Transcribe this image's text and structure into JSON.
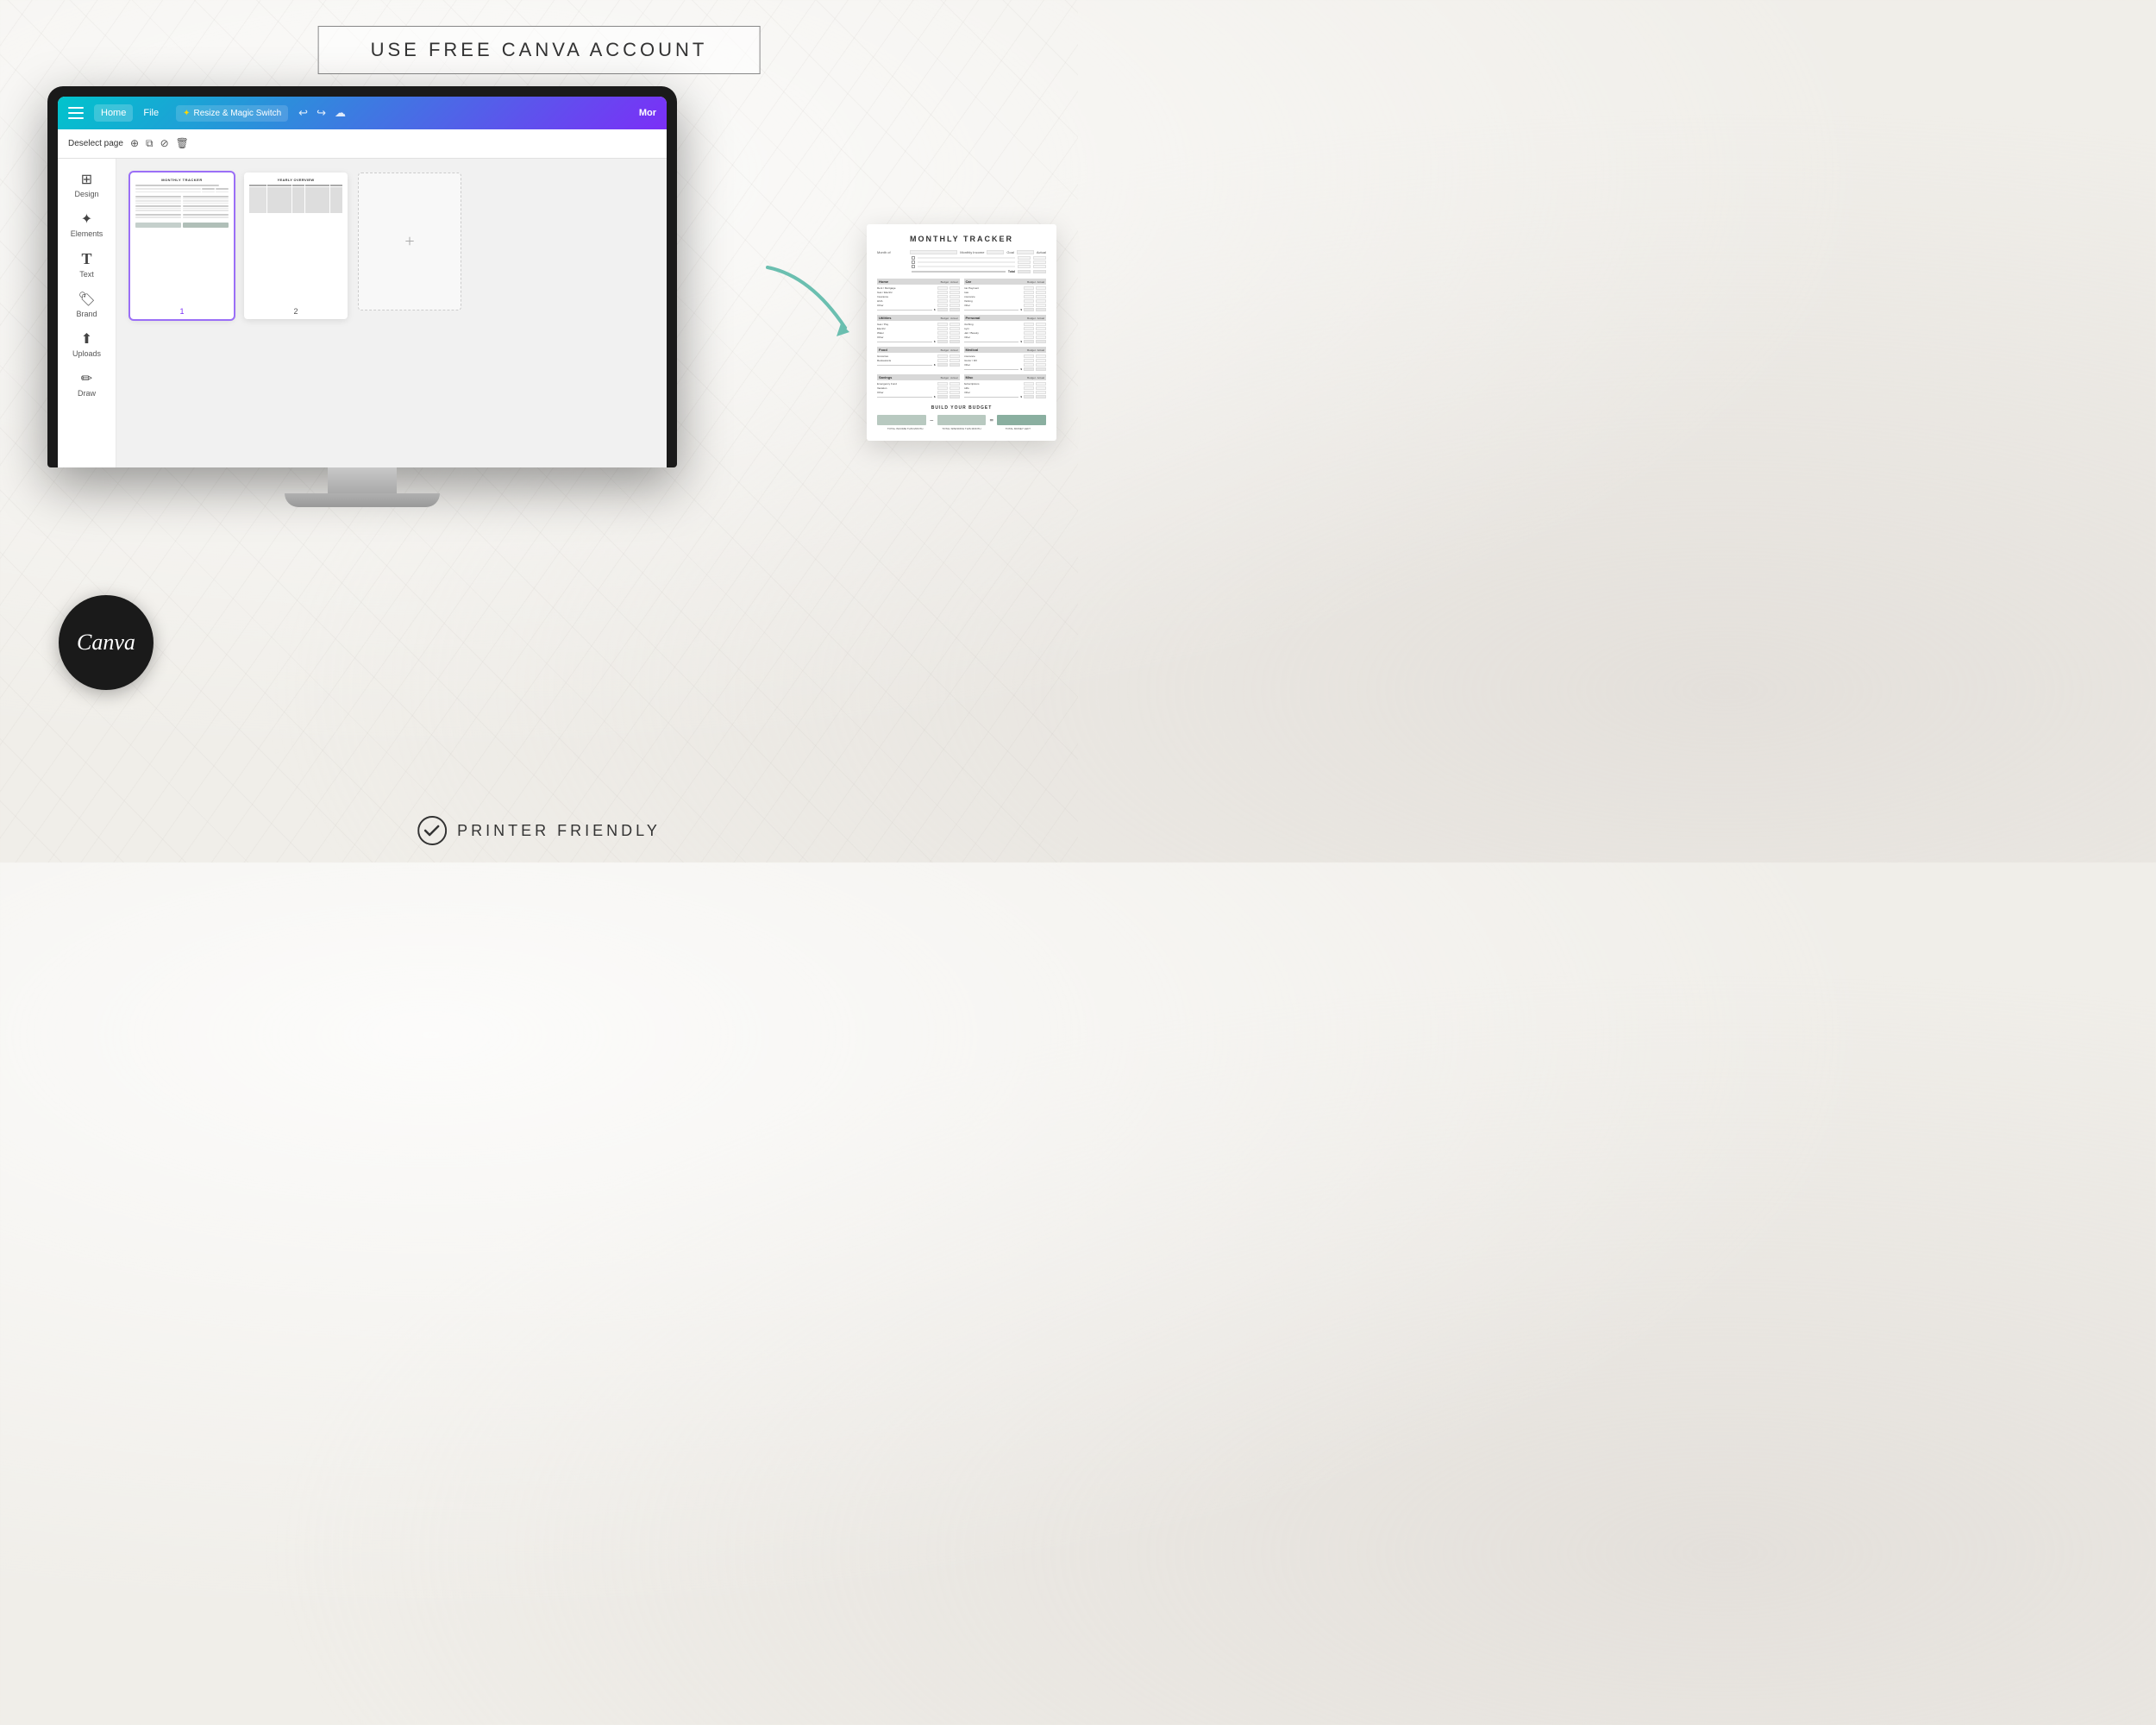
{
  "banner": {
    "text": "USE FREE CANVA ACCOUNT"
  },
  "toolbar": {
    "home_label": "Home",
    "file_label": "File",
    "magic_switch_label": "Resize & Magic Switch",
    "more_label": "Mor"
  },
  "secondary_toolbar": {
    "deselect_label": "Deselect page"
  },
  "sidebar": {
    "items": [
      {
        "label": "Design",
        "icon": "⊞"
      },
      {
        "label": "Elements",
        "icon": "❋"
      },
      {
        "label": "Text",
        "icon": "T"
      },
      {
        "label": "Brand",
        "icon": "🏷"
      },
      {
        "label": "Uploads",
        "icon": "↑"
      },
      {
        "label": "Draw",
        "icon": "✏"
      }
    ]
  },
  "pages": [
    {
      "label": "1",
      "title": "MONTHLY TRACKER",
      "selected": true
    },
    {
      "label": "2",
      "title": "YEARLY OVERVIEW",
      "selected": false
    },
    {
      "label": "+",
      "title": "",
      "selected": false
    }
  ],
  "monthly_tracker": {
    "title": "MONTHLY TRACKER",
    "sections": {
      "income": {
        "label": "Monthly Income",
        "cols": [
          "Goal",
          "Actual"
        ]
      },
      "home": {
        "label": "Home",
        "cols": [
          "Budget",
          "Actual"
        ],
        "rows": [
          "Rent / Mortgage",
          "Gas / Electric",
          "Insurance",
          "HOA",
          "Other"
        ]
      },
      "car": {
        "label": "Car",
        "cols": [
          "Budget",
          "Actual"
        ],
        "rows": [
          "Car Payment",
          "Gas",
          "Insurance",
          "Parking",
          "Other"
        ]
      },
      "utilities": {
        "label": "Utilities",
        "cols": [
          "Budget",
          "Actual"
        ],
        "rows": [
          "Gas / Pay",
          "Electric",
          "Water",
          "Other"
        ]
      },
      "personal": {
        "label": "Personal",
        "cols": [
          "Budget",
          "Actual"
        ],
        "rows": [
          "Clothing",
          "Gym",
          "Hair / Beauty",
          "Other"
        ]
      },
      "food": {
        "label": "Food",
        "cols": [
          "Budget",
          "Actual"
        ],
        "rows": [
          "Groceries",
          "Restaurants"
        ]
      },
      "medical": {
        "label": "Medical",
        "cols": [
          "Budget",
          "Actual"
        ],
        "rows": [
          "Insurance",
          "Doctor / RX",
          "Other"
        ]
      },
      "savings": {
        "label": "Savings",
        "cols": [
          "Budget",
          "Actual"
        ],
        "rows": [
          "Emergency Fund",
          "Vacation",
          "Other"
        ]
      },
      "misc": {
        "label": "Misc",
        "cols": [
          "Budget",
          "Actual"
        ],
        "rows": [
          "Subscriptions",
          "Gifts",
          "Other"
        ]
      }
    },
    "footer": {
      "title": "BUILD YOUR BUDGET",
      "box1_label": "TOTAL INCOME THIS MONTH",
      "minus": "−",
      "box2_label": "TOTAL SPENDING THIS MONTH",
      "equals": "=",
      "box3_label": "TOTAL MONEY LEFT"
    }
  },
  "canva_logo": {
    "text": "Canva"
  },
  "printer_friendly": {
    "text": "PRINTER FRIENDLY"
  }
}
